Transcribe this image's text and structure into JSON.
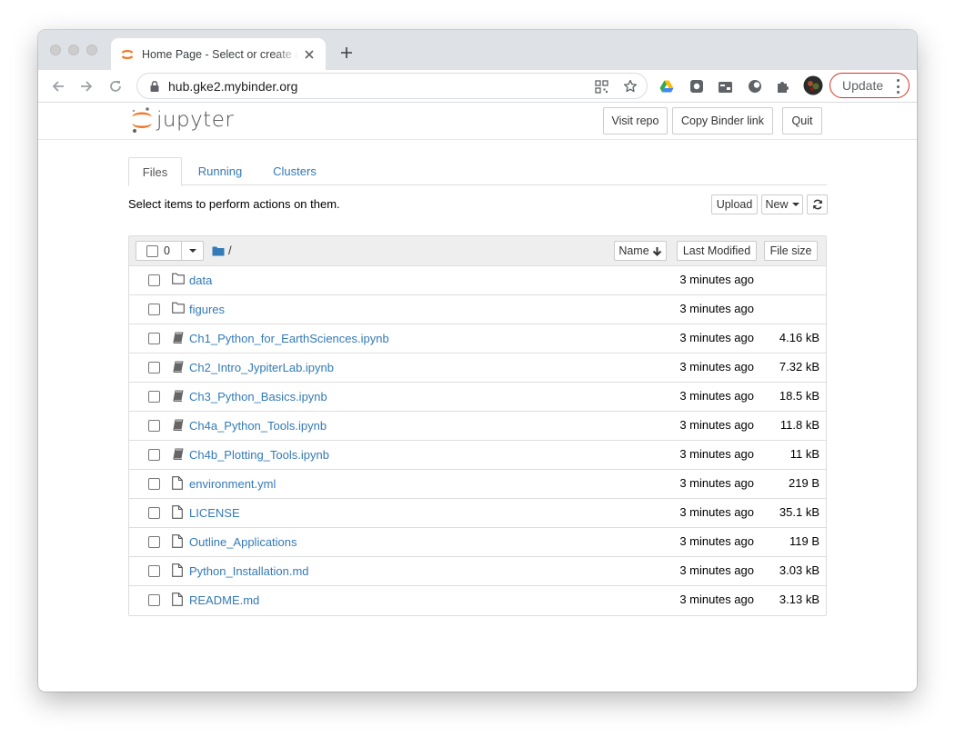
{
  "browser": {
    "tab_title": "Home Page - Select or create a notebook",
    "url": "hub.gke2.mybinder.org",
    "update_label": "Update",
    "accent_color": "#d93025"
  },
  "header": {
    "logo_text": "jupyter",
    "visit_repo": "Visit repo",
    "copy_binder_link": "Copy Binder link",
    "quit": "Quit"
  },
  "tabs": {
    "files": "Files",
    "running": "Running",
    "clusters": "Clusters"
  },
  "toolbar": {
    "hint": "Select items to perform actions on them.",
    "upload": "Upload",
    "new": "New"
  },
  "list": {
    "selected_count": "0",
    "path": "/",
    "col_name": "Name",
    "col_modified": "Last Modified",
    "col_size": "File size",
    "items": [
      {
        "name": "data",
        "type": "folder",
        "modified": "3 minutes ago",
        "size": ""
      },
      {
        "name": "figures",
        "type": "folder",
        "modified": "3 minutes ago",
        "size": ""
      },
      {
        "name": "Ch1_Python_for_EarthSciences.ipynb",
        "type": "notebook",
        "modified": "3 minutes ago",
        "size": "4.16 kB"
      },
      {
        "name": "Ch2_Intro_JypiterLab.ipynb",
        "type": "notebook",
        "modified": "3 minutes ago",
        "size": "7.32 kB"
      },
      {
        "name": "Ch3_Python_Basics.ipynb",
        "type": "notebook",
        "modified": "3 minutes ago",
        "size": "18.5 kB"
      },
      {
        "name": "Ch4a_Python_Tools.ipynb",
        "type": "notebook",
        "modified": "3 minutes ago",
        "size": "11.8 kB"
      },
      {
        "name": "Ch4b_Plotting_Tools.ipynb",
        "type": "notebook",
        "modified": "3 minutes ago",
        "size": "11 kB"
      },
      {
        "name": "environment.yml",
        "type": "file",
        "modified": "3 minutes ago",
        "size": "219 B"
      },
      {
        "name": "LICENSE",
        "type": "file",
        "modified": "3 minutes ago",
        "size": "35.1 kB"
      },
      {
        "name": "Outline_Applications",
        "type": "file",
        "modified": "3 minutes ago",
        "size": "119 B"
      },
      {
        "name": "Python_Installation.md",
        "type": "file",
        "modified": "3 minutes ago",
        "size": "3.03 kB"
      },
      {
        "name": "README.md",
        "type": "file",
        "modified": "3 minutes ago",
        "size": "3.13 kB"
      }
    ]
  }
}
